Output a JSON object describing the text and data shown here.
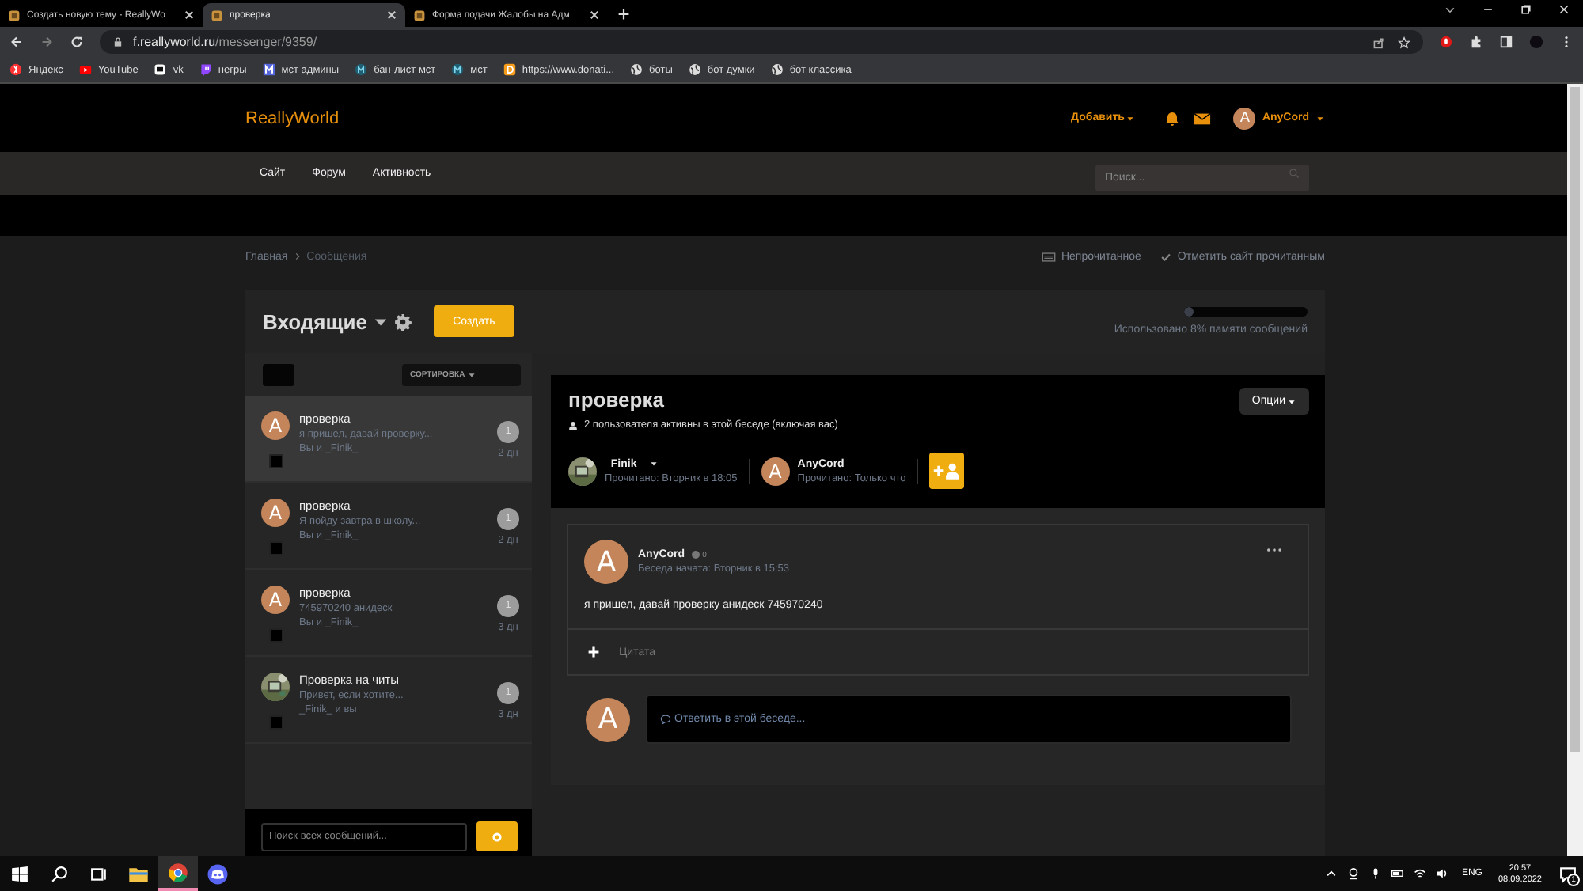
{
  "browser": {
    "tabs": [
      {
        "title": "Создать новую тему - ReallyWo",
        "selected": false
      },
      {
        "title": "проверка",
        "selected": true
      },
      {
        "title": "Форма подачи Жалобы на Адм",
        "selected": false
      }
    ],
    "url_host": "f.reallyworld.ru",
    "url_path": "/messenger/9359/",
    "bookmarks": [
      {
        "label": "Яндекс",
        "kind": "ya"
      },
      {
        "label": "YouTube",
        "kind": "video"
      },
      {
        "label": "vk",
        "kind": "chat"
      },
      {
        "label": "негры",
        "kind": "stream"
      },
      {
        "label": "мст админы",
        "kind": "square-m"
      },
      {
        "label": "бан-лист мст",
        "kind": "round-m"
      },
      {
        "label": "мст",
        "kind": "round-m"
      },
      {
        "label": "https://www.donati...",
        "kind": "donate"
      },
      {
        "label": "боты",
        "kind": "globe"
      },
      {
        "label": "бот думки",
        "kind": "globe"
      },
      {
        "label": "бот классика",
        "kind": "globe"
      }
    ]
  },
  "site": {
    "logo": "ReallyWorld",
    "add_menu": "Добавить",
    "user": {
      "avatar_letter": "A",
      "name": "AnyCord"
    },
    "nav": [
      "Сайт",
      "Форум",
      "Активность"
    ],
    "search": {
      "placeholder": "Поиск..."
    }
  },
  "breadcrumb": [
    "Главная",
    "Сообщения"
  ],
  "actions": [
    "Непрочитанное",
    "Отметить сайт прочитанным"
  ],
  "inbox": {
    "title": "Входящие",
    "create": "Создать",
    "memory": {
      "level": 0.08,
      "caption": "Использовано 8% памяти сообщений"
    },
    "sort": "СОРТИРОВКА",
    "conversations": [
      {
        "title": "проверка",
        "preview": "я пришел, давай проверку...",
        "participants": "Вы и _Finik_",
        "count": "1",
        "age": "2 дн",
        "selected": true,
        "checked": false,
        "avatar": {
          "kind": "letter",
          "letter": "A"
        }
      },
      {
        "title": "проверка",
        "preview": "Я пойду завтра в школу...",
        "participants": "Вы и _Finik_",
        "count": "1",
        "age": "2 дн",
        "selected": false,
        "checked": false,
        "avatar": {
          "kind": "letter",
          "letter": "A"
        }
      },
      {
        "title": "проверка",
        "preview": "745970240 анидеск",
        "participants": "Вы и _Finik_",
        "count": "1",
        "age": "3 дн",
        "selected": false,
        "checked": false,
        "avatar": {
          "kind": "letter",
          "letter": "A"
        }
      },
      {
        "title": "Проверка на читы",
        "preview": "Привет, если хотите...",
        "participants": "_Finik_ и вы",
        "count": "1",
        "age": "3 дн",
        "selected": false,
        "checked": false
      }
    ],
    "search": {
      "placeholder": "Поиск всех сообщений..."
    }
  },
  "conversation": {
    "title": "проверка",
    "active_note": "2 пользователя активны в этой беседе (включая вас)",
    "options": "Опции",
    "participants": [
      {
        "name": "_Finik_",
        "read": "Прочитано: Вторник в 18:05",
        "has_menu": true
      },
      {
        "name": "AnyCord",
        "read": "Прочитано: Только что",
        "has_menu": false,
        "avatar": {
          "kind": "letter",
          "letter": "A"
        }
      }
    ],
    "post": {
      "author": "AnyCord",
      "reputation": "0",
      "started": "Беседа начата: Вторник в 15:53",
      "body": "я пришел, давай проверку анидеск 745970240",
      "avatar_letter": "A",
      "quote": "Цитата"
    },
    "reply": {
      "avatar_letter": "A",
      "placeholder": "Ответить в этой беседе..."
    }
  },
  "taskbar": {
    "apps": [
      {
        "kind": "start",
        "active": false
      },
      {
        "kind": "search",
        "active": false
      },
      {
        "kind": "tasks",
        "active": false
      },
      {
        "kind": "folder",
        "active": false
      },
      {
        "kind": "browser",
        "active": true
      },
      {
        "kind": "discord",
        "active": false
      }
    ],
    "language": "ENG",
    "time": "20:57",
    "date": "08.09.2022",
    "notifications": "1"
  }
}
